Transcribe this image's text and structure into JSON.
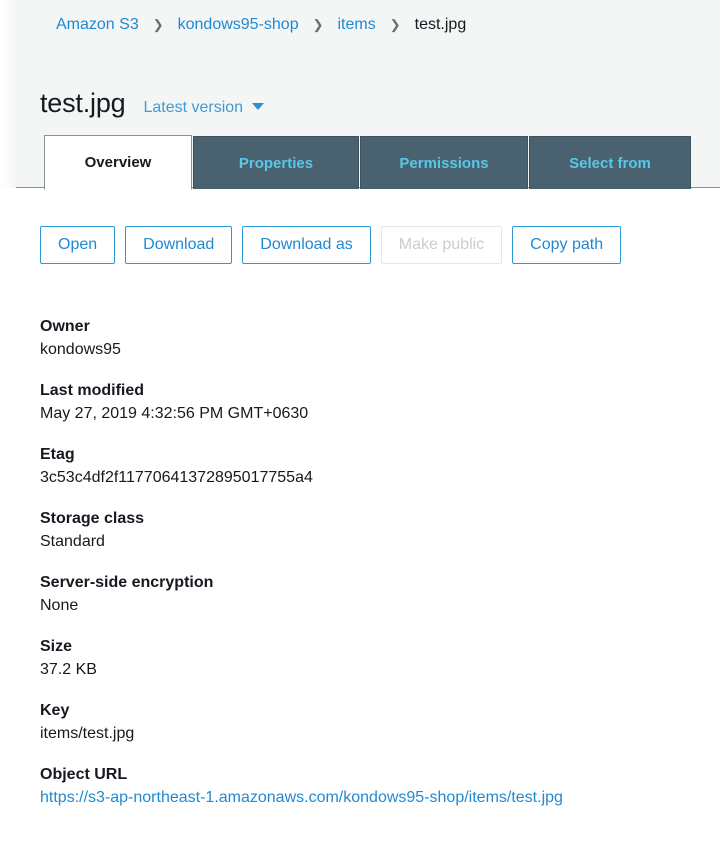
{
  "breadcrumb": {
    "separator": "❯",
    "items": [
      {
        "label": "Amazon S3",
        "link": true
      },
      {
        "label": "kondows95-shop",
        "link": true
      },
      {
        "label": "items",
        "link": true
      },
      {
        "label": "test.jpg",
        "link": false
      }
    ]
  },
  "header": {
    "title": "test.jpg",
    "version_selector": "Latest version"
  },
  "tabs": [
    {
      "label": "Overview",
      "active": true
    },
    {
      "label": "Properties",
      "active": false
    },
    {
      "label": "Permissions",
      "active": false
    },
    {
      "label": "Select from",
      "active": false
    }
  ],
  "actions": [
    {
      "label": "Open",
      "disabled": false
    },
    {
      "label": "Download",
      "disabled": false
    },
    {
      "label": "Download as",
      "disabled": false
    },
    {
      "label": "Make public",
      "disabled": true
    },
    {
      "label": "Copy path",
      "disabled": false
    }
  ],
  "details": [
    {
      "label": "Owner",
      "value": "kondows95",
      "is_link": false
    },
    {
      "label": "Last modified",
      "value": "May 27, 2019 4:32:56 PM GMT+0630",
      "is_link": false
    },
    {
      "label": "Etag",
      "value": "3c53c4df2f11770641372895017755a4",
      "is_link": false
    },
    {
      "label": "Storage class",
      "value": "Standard",
      "is_link": false
    },
    {
      "label": "Server-side encryption",
      "value": "None",
      "is_link": false
    },
    {
      "label": "Size",
      "value": "37.2 KB",
      "is_link": false
    },
    {
      "label": "Key",
      "value": "items/test.jpg",
      "is_link": false
    },
    {
      "label": "Object URL",
      "value": "https://s3-ap-northeast-1.amazonaws.com/kondows95-shop/items/test.jpg",
      "is_link": true
    }
  ],
  "colors": {
    "link_blue": "#1f8ad2",
    "tab_inactive_bg": "#4a626f",
    "tab_inactive_text": "#59c7e8",
    "header_bg": "#f4f5f5",
    "disabled_text": "#c9cdd1"
  }
}
